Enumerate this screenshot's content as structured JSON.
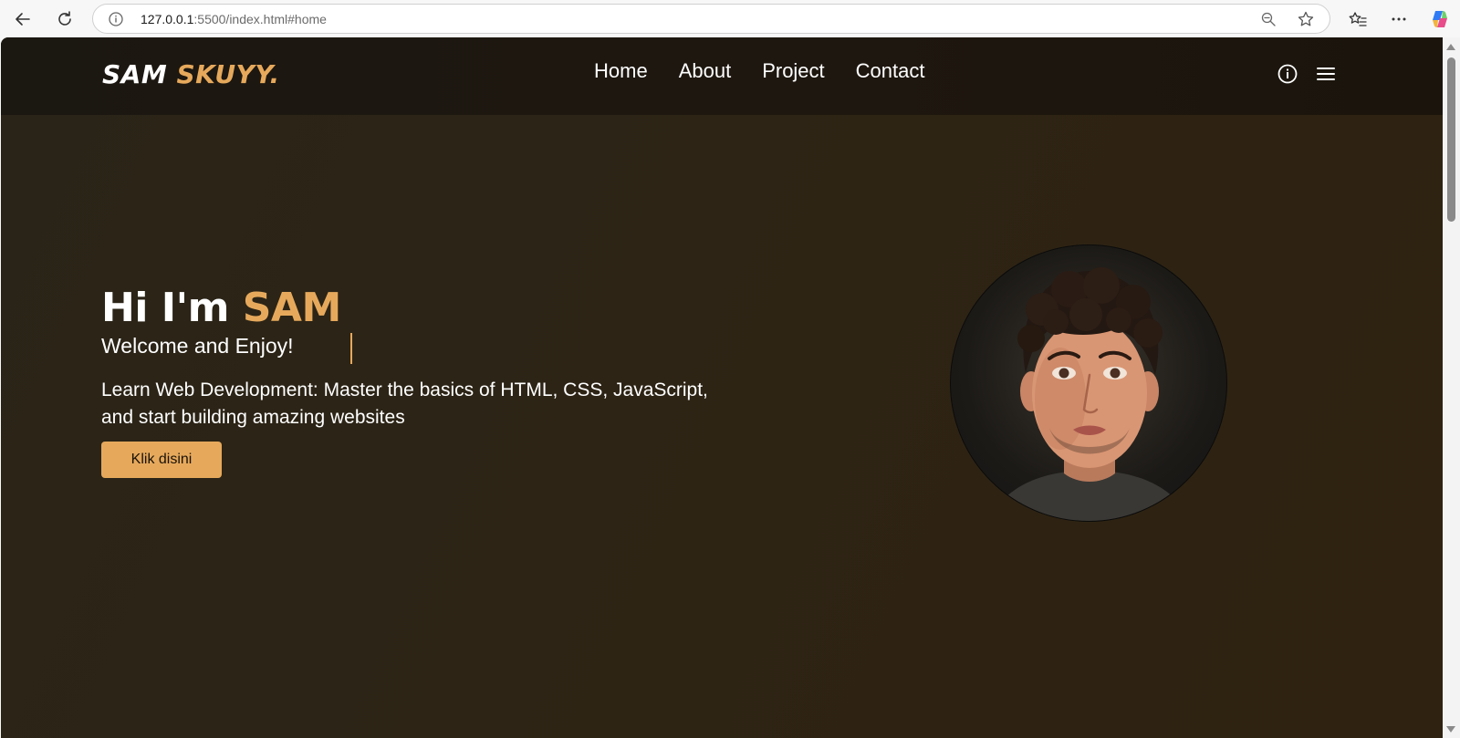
{
  "browser": {
    "url_host": "127.0.0.1",
    "url_rest": ":5500/index.html#home"
  },
  "site": {
    "logo_main": "SAM ",
    "logo_accent": "SKUYY.",
    "nav": [
      {
        "label": "Home"
      },
      {
        "label": "About"
      },
      {
        "label": "Project"
      },
      {
        "label": "Contact"
      }
    ]
  },
  "hero": {
    "title_prefix": "Hi I'm ",
    "title_name": "SAM",
    "subtitle": "Welcome and Enjoy!",
    "description": "Learn Web Development: Master the basics of HTML, CSS, JavaScript, and start building amazing websites",
    "button_label": "Klik disini"
  },
  "colors": {
    "accent": "#e6a95c",
    "header_bg": "#1c1610",
    "page_bg": "#2c2416"
  }
}
